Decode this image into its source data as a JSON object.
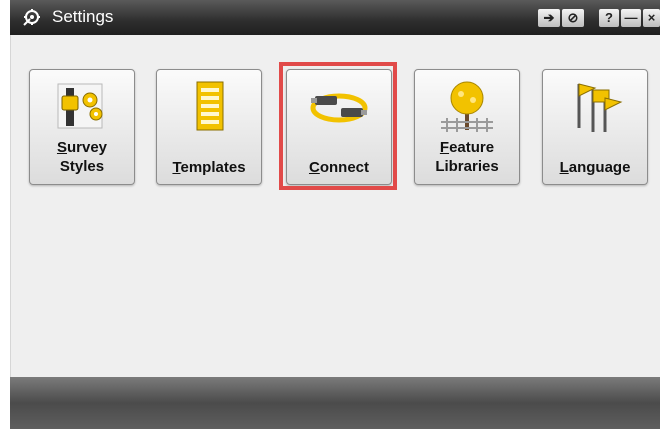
{
  "window": {
    "title": "Settings",
    "app_icon": "gear-wrench-icon"
  },
  "titlebar_buttons": [
    {
      "name": "back-icon",
      "glyph": "➔"
    },
    {
      "name": "cancel-icon",
      "glyph": "⊘"
    },
    {
      "name": "help-icon",
      "glyph": "?"
    },
    {
      "name": "minimize-icon",
      "glyph": "—"
    },
    {
      "name": "close-icon",
      "glyph": "×"
    }
  ],
  "tiles": [
    {
      "label_line1_ul": "S",
      "label_line1_rest": "urvey",
      "label_line2": "Styles",
      "icon": "survey-styles-icon"
    },
    {
      "label_line1_ul": "T",
      "label_line1_rest": "emplates",
      "label_line2": "",
      "icon": "templates-icon"
    },
    {
      "label_line1_ul": "C",
      "label_line1_rest": "onnect",
      "label_line2": "",
      "icon": "connect-cable-icon",
      "selected": true
    },
    {
      "label_line1_ul": "F",
      "label_line1_rest": "eature",
      "label_line2": "Libraries",
      "icon": "feature-libraries-icon"
    },
    {
      "label_line1_ul": "L",
      "label_line1_rest": "anguage",
      "label_line2": "",
      "icon": "language-flags-icon"
    }
  ],
  "colors": {
    "highlight": "#e14a49",
    "accent_yellow": "#f2c200"
  }
}
